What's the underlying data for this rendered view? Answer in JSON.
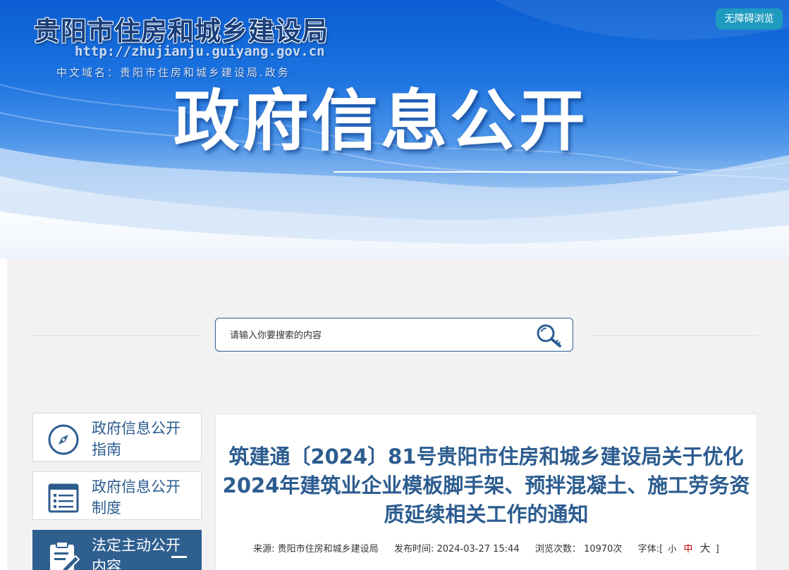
{
  "banner": {
    "site_name": "贵阳市住房和城乡建设局",
    "site_url": "http://zhujianju.guiyang.gov.cn",
    "cn_domain": "中文域名：贵阳市住房和城乡建设局.政务",
    "title": "政府信息公开",
    "accessibility_label": "无障碍浏览"
  },
  "search": {
    "placeholder": "请输入你要搜索的内容"
  },
  "sidebar": {
    "items": [
      {
        "label": "政府信息公开指南",
        "icon": "compass-icon"
      },
      {
        "label": "政府信息公开制度",
        "icon": "list-icon"
      },
      {
        "label": "法定主动公开内容",
        "icon": "clipboard-edit-icon"
      }
    ]
  },
  "article": {
    "title": "筑建通〔2024〕81号贵阳市住房和城乡建设局关于优化2024年建筑业企业模板脚手架、预拌混凝土、施工劳务资质延续相关工作的通知",
    "source_label": "来源:",
    "source": "贵阳市住房和城乡建设局",
    "publish_label": "发布时间:",
    "publish_time": "2024-03-27 15:44",
    "views_label": "浏览次数：",
    "views": "10970次",
    "font_label": "字体:[",
    "font_small": "小",
    "font_medium": "中",
    "font_large": "大",
    "font_close": "]"
  },
  "colors": {
    "primary": "#2c5c8f",
    "accent_red": "#cc0000",
    "a11y_button": "#1f9bbf"
  }
}
